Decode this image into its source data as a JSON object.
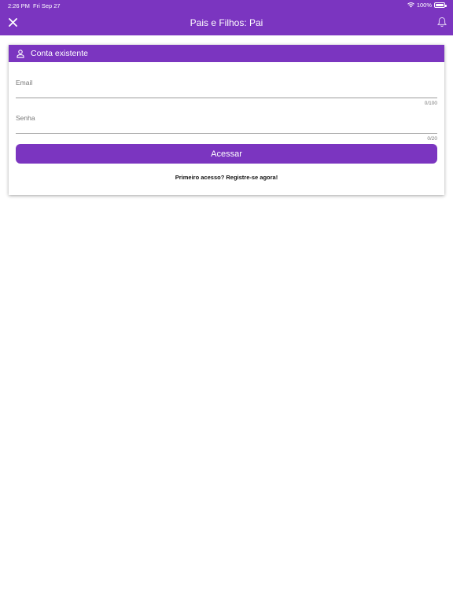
{
  "status_bar": {
    "time": "2:26 PM",
    "date": "Fri Sep 27",
    "battery": "100%"
  },
  "nav": {
    "title": "Pais e Filhos: Pai",
    "close_icon": "close-icon",
    "bell_icon": "bell-icon"
  },
  "card": {
    "header_icon": "person-icon",
    "header_title": "Conta existente",
    "email": {
      "label": "Email",
      "value": "",
      "counter": "0/100"
    },
    "password": {
      "label": "Senha",
      "value": "",
      "counter": "0/20"
    },
    "submit_label": "Acessar",
    "register_text": "Primeiro acesso? Registre-se agora!"
  },
  "colors": {
    "brand": "#7b35c0"
  }
}
